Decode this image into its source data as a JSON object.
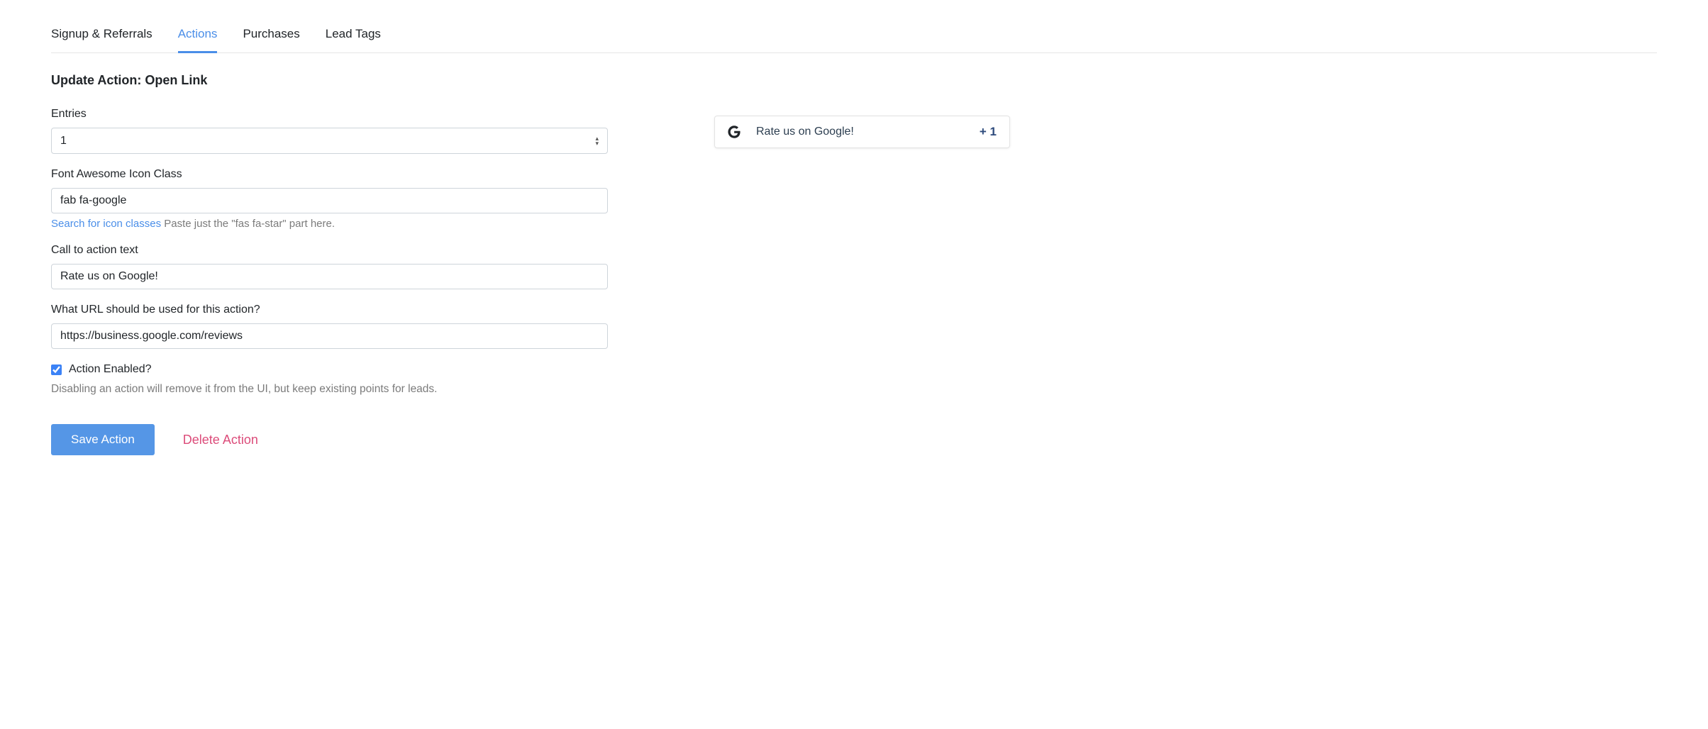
{
  "tabs": [
    {
      "label": "Signup & Referrals",
      "active": false
    },
    {
      "label": "Actions",
      "active": true
    },
    {
      "label": "Purchases",
      "active": false
    },
    {
      "label": "Lead Tags",
      "active": false
    }
  ],
  "page_title": "Update Action: Open Link",
  "fields": {
    "entries": {
      "label": "Entries",
      "value": "1"
    },
    "icon_class": {
      "label": "Font Awesome Icon Class",
      "value": "fab fa-google",
      "link_text": "Search for icon classes",
      "helper": " Paste just the \"fas fa-star\" part here."
    },
    "cta": {
      "label": "Call to action text",
      "value": "Rate us on Google!"
    },
    "url": {
      "label": "What URL should be used for this action?",
      "value": "https://business.google.com/reviews"
    },
    "enabled": {
      "label": "Action Enabled?",
      "checked": true,
      "note": "Disabling an action will remove it from the UI, but keep existing points for leads."
    }
  },
  "buttons": {
    "save": "Save Action",
    "delete": "Delete Action"
  },
  "preview": {
    "text": "Rate us on Google!",
    "points": "+ 1"
  }
}
